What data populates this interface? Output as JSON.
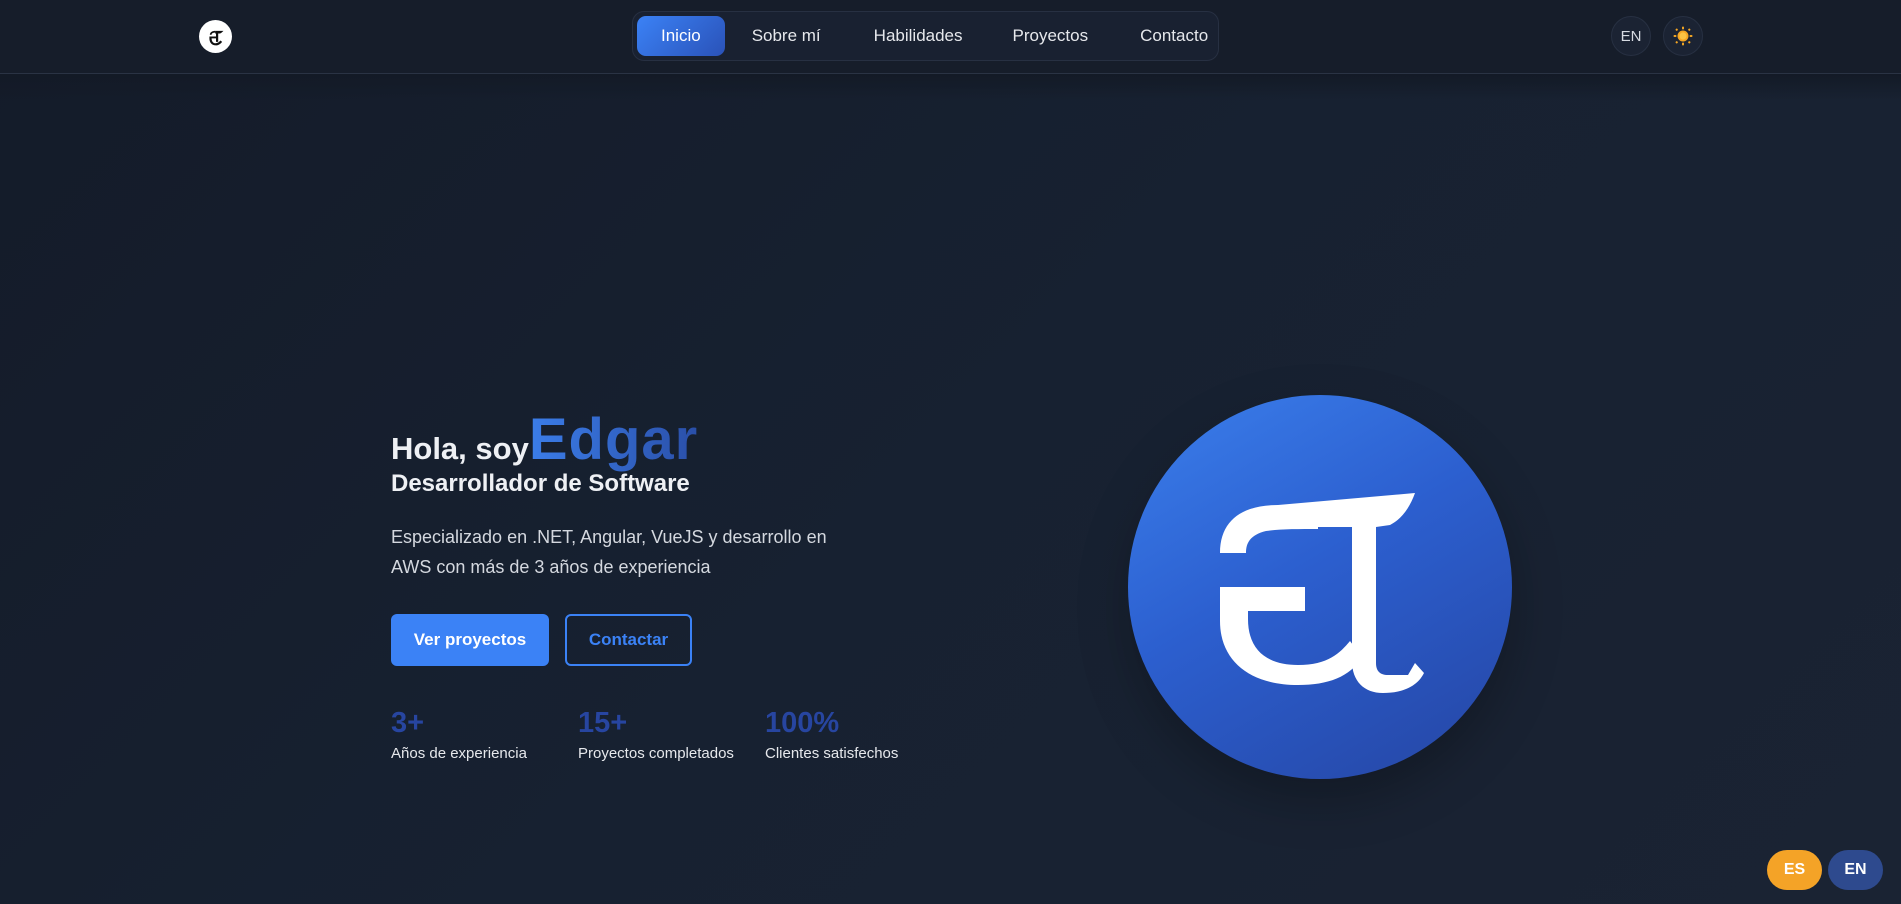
{
  "header": {
    "logo_icon": "ej-monogram-icon",
    "nav": [
      {
        "label": "Inicio",
        "active": true
      },
      {
        "label": "Sobre mí",
        "active": false
      },
      {
        "label": "Habilidades",
        "active": false
      },
      {
        "label": "Proyectos",
        "active": false
      },
      {
        "label": "Contacto",
        "active": false
      }
    ],
    "lang_toggle": "EN",
    "theme_icon": "sun-icon"
  },
  "hero": {
    "greeting": "Hola, soy",
    "name": "Edgar",
    "role": "Desarrollador de Software",
    "description": "Especializado en .NET, Angular, VueJS y desarrollo en AWS con más de 3 años de experiencia",
    "primary_button": "Ver proyectos",
    "secondary_button": "Contactar",
    "stats": [
      {
        "value": "3+",
        "label": "Años de experiencia"
      },
      {
        "value": "15+",
        "label": "Proyectos completados"
      },
      {
        "value": "100%",
        "label": "Clientes satisfechos"
      }
    ],
    "avatar_icon": "ej-monogram-icon"
  },
  "language_switcher": {
    "es": "ES",
    "en": "EN"
  },
  "colors": {
    "accent": "#3b82f6",
    "accent_dark": "#2545a3",
    "background": "#172030",
    "es_pill": "#f4a327",
    "en_pill": "#2e4a8e"
  }
}
